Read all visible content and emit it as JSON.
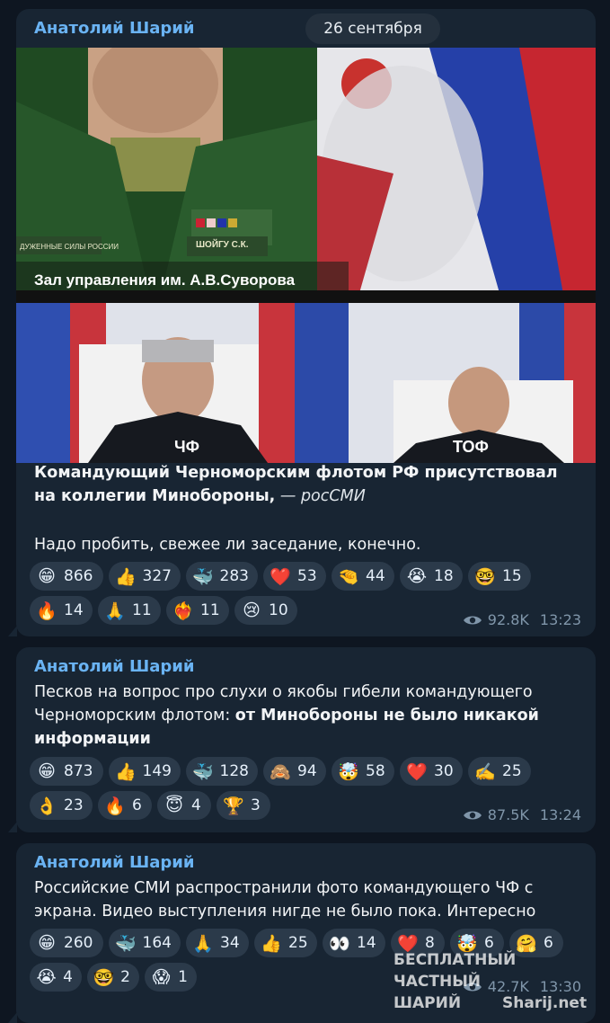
{
  "messages": [
    {
      "author": "Анатолий Шарий",
      "date": "26 сентября",
      "photo_caption": "Зал управления им. А.В.Суворова",
      "photo_tags": [
        "ШОЙГУ С.К.",
        "ЧФ",
        "ТОФ",
        "ДУЖЕННЫЕ СИЛЫ РОССИИ"
      ],
      "headline": "Командующий Черноморским флотом РФ присутствовал на коллегии Минобороны,",
      "source": "— росСМИ",
      "body": "Надо пробить, свежее ли заседание, конечно.",
      "reactions": [
        {
          "emoji": "😁",
          "count": "866"
        },
        {
          "emoji": "👍",
          "count": "327"
        },
        {
          "emoji": "🐳",
          "count": "283"
        },
        {
          "emoji": "❤️",
          "count": "53"
        },
        {
          "emoji": "🤏",
          "count": "44"
        },
        {
          "emoji": "😭",
          "count": "18"
        },
        {
          "emoji": "🤓",
          "count": "15"
        },
        {
          "emoji": "🔥",
          "count": "14"
        },
        {
          "emoji": "🙏",
          "count": "11"
        },
        {
          "emoji": "❤️‍🔥",
          "count": "11"
        },
        {
          "emoji": "😢",
          "count": "10"
        }
      ],
      "views": "92.8K",
      "time": "13:23"
    },
    {
      "author": "Анатолий Шарий",
      "text_plain": "Песков на вопрос про слухи о якобы гибели командующего Черноморским флотом: ",
      "text_bold": "от Минобороны не было никакой информации",
      "reactions": [
        {
          "emoji": "😁",
          "count": "873"
        },
        {
          "emoji": "👍",
          "count": "149"
        },
        {
          "emoji": "🐳",
          "count": "128"
        },
        {
          "emoji": "🙈",
          "count": "94"
        },
        {
          "emoji": "🤯",
          "count": "58"
        },
        {
          "emoji": "❤️",
          "count": "30"
        },
        {
          "emoji": "✍️",
          "count": "25"
        },
        {
          "emoji": "👌",
          "count": "23"
        },
        {
          "emoji": "🔥",
          "count": "6"
        },
        {
          "emoji": "😇",
          "count": "4"
        },
        {
          "emoji": "🏆",
          "count": "3"
        }
      ],
      "views": "87.5K",
      "time": "13:24"
    },
    {
      "author": "Анатолий Шарий",
      "text": "Российские СМИ распространили фото командующего ЧФ с экрана. Видео выступления нигде не было пока. Интересно",
      "reactions": [
        {
          "emoji": "😁",
          "count": "260"
        },
        {
          "emoji": "🐳",
          "count": "164"
        },
        {
          "emoji": "🙏",
          "count": "34"
        },
        {
          "emoji": "👍",
          "count": "25"
        },
        {
          "emoji": "👀",
          "count": "14"
        },
        {
          "emoji": "❤️",
          "count": "8"
        },
        {
          "emoji": "🤯",
          "count": "6"
        },
        {
          "emoji": "🤗",
          "count": "6"
        },
        {
          "emoji": "😭",
          "count": "4"
        },
        {
          "emoji": "🤓",
          "count": "2"
        },
        {
          "emoji": "😱",
          "count": "1"
        }
      ],
      "views": "42.7K",
      "time": "13:30"
    }
  ],
  "watermark": {
    "line1": "БЕСПЛАТНЫЙ ЧАСТНЫЙ",
    "line2": "ШАРИЙ",
    "line3": "Sharij.net"
  },
  "colors": {
    "background": "#0e1621",
    "bubble": "#182533",
    "author": "#6ab3f3",
    "reaction": "#2b3a4a",
    "meta": "#8096aa"
  }
}
